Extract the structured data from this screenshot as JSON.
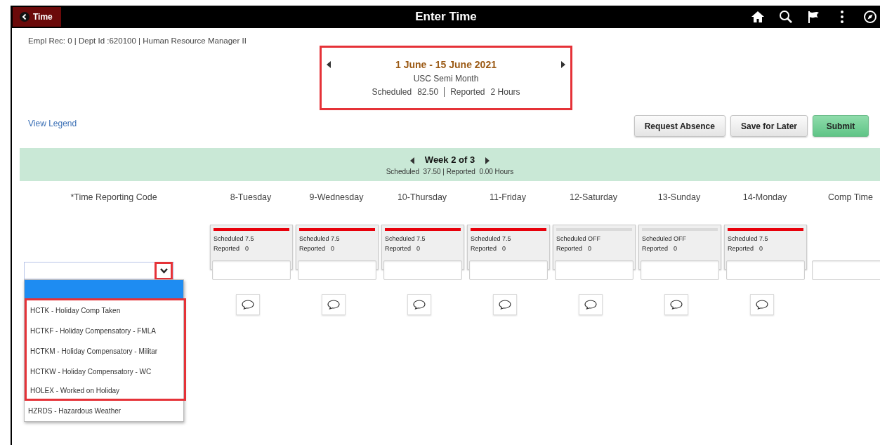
{
  "top_bar": {
    "back_label": "Time",
    "title": "Enter Time"
  },
  "employee_line": "Empl Rec: 0 | Dept Id :620100 | Human Resource Manager II",
  "period": {
    "highlighted": true,
    "title": "1 June - 15 June 2021",
    "schedule": "USC Semi Month",
    "scheduled_label": "Scheduled",
    "scheduled_value": "82.50",
    "reported_label": "Reported",
    "reported_value": "2 Hours"
  },
  "view_legend": "View Legend",
  "buttons": [
    {
      "label": "Request Absence",
      "kind": "plain"
    },
    {
      "label": "Save for Later",
      "kind": "plain"
    },
    {
      "label": "Submit",
      "kind": "primary"
    }
  ],
  "week": {
    "title": "Week 2 of 3",
    "summary": "Scheduled  37.50 | Reported  0.00 Hours"
  },
  "trc_header": "*Time Reporting Code",
  "days": [
    {
      "label": "8-Tuesday",
      "card": {
        "scheduled": "Scheduled 7.5",
        "reported_label": "Reported",
        "reported_value": "0",
        "color": "#e8000b"
      }
    },
    {
      "label": "9-Wednesday",
      "card": {
        "scheduled": "Scheduled 7.5",
        "reported_label": "Reported",
        "reported_value": "0",
        "color": "#e8000b"
      }
    },
    {
      "label": "10-Thursday",
      "card": {
        "scheduled": "Scheduled 7.5",
        "reported_label": "Reported",
        "reported_value": "0",
        "color": "#e8000b"
      }
    },
    {
      "label": "11-Friday",
      "card": {
        "scheduled": "Scheduled 7.5",
        "reported_label": "Reported",
        "reported_value": "0",
        "color": "#e8000b"
      }
    },
    {
      "label": "12-Saturday",
      "card": {
        "scheduled": "Scheduled OFF",
        "reported_label": "Reported",
        "reported_value": "0",
        "color": "#dadada"
      }
    },
    {
      "label": "13-Sunday",
      "card": {
        "scheduled": "Scheduled OFF",
        "reported_label": "Reported",
        "reported_value": "0",
        "color": "#dadada"
      }
    },
    {
      "label": "14-Monday",
      "card": {
        "scheduled": "Scheduled 7.5",
        "reported_label": "Reported",
        "reported_value": "0",
        "color": "#e8000b"
      }
    },
    {
      "label": "Comp Time"
    }
  ],
  "trc_dropdown": {
    "arrow_highlighted": true,
    "blank_selected": true,
    "highlighted_options": [
      {
        "label": "HCTK - Holiday Comp Taken",
        "selected": false
      },
      {
        "label": "HCTKF - Holiday Compensatory - FMLA",
        "selected": false
      },
      {
        "label": "HCTKM - Holiday Compensatory - Militar",
        "selected": false
      },
      {
        "label": "HCTKW - Holiday Compensatory - WC",
        "selected": false
      },
      {
        "label": "HOLEX - Worked on Holiday",
        "selected": false
      }
    ],
    "other_options": [
      {
        "label": "HZRDS - Hazardous Weather",
        "selected": false
      }
    ]
  }
}
